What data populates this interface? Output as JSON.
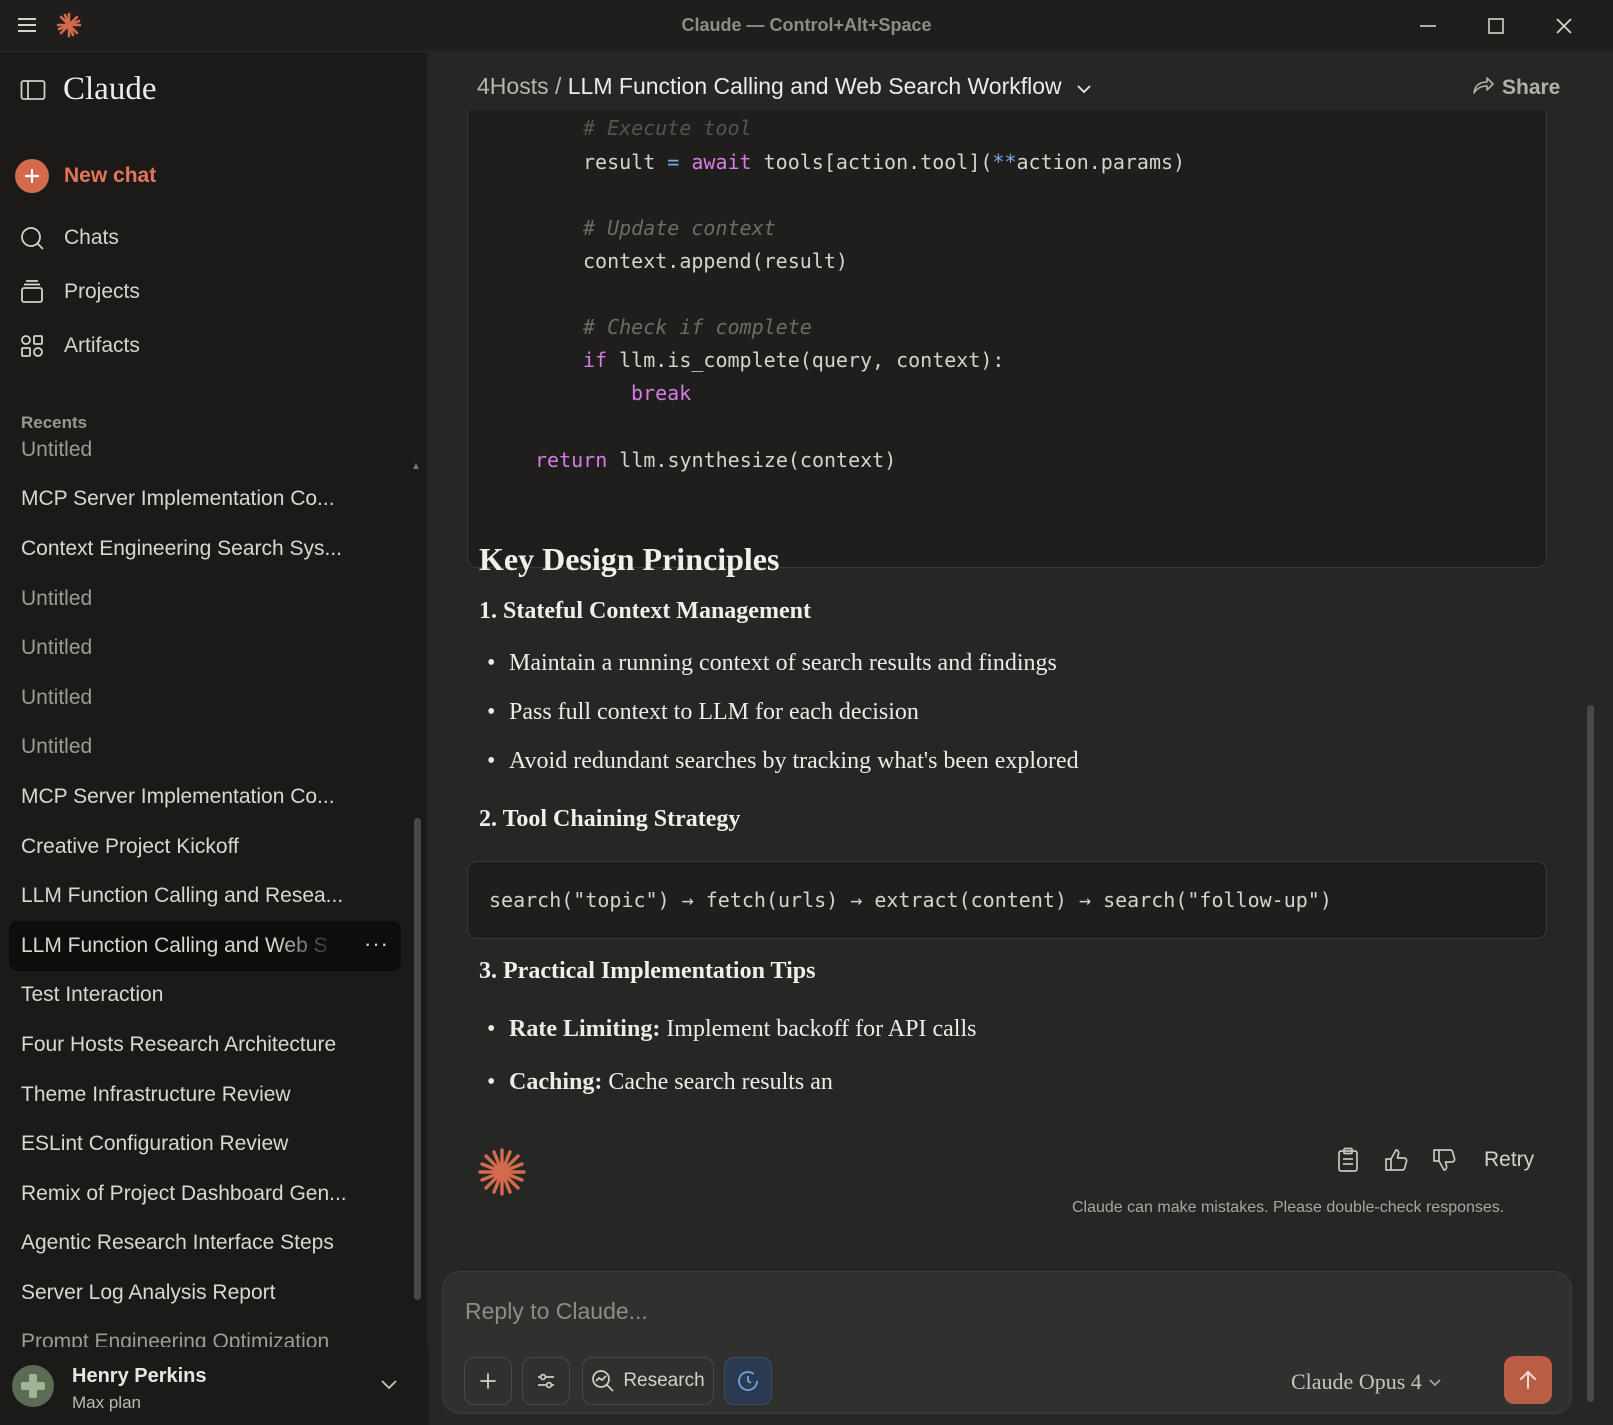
{
  "window": {
    "title": "Claude — Control+Alt+Space",
    "controls": [
      "minimize-icon",
      "maximize-icon",
      "close-icon"
    ]
  },
  "sidebar": {
    "brand": "Claude",
    "new_chat": "New chat",
    "nav": [
      {
        "label": "Chats",
        "icon": "chat-search-icon"
      },
      {
        "label": "Projects",
        "icon": "projects-icon"
      },
      {
        "label": "Artifacts",
        "icon": "artifacts-icon"
      }
    ],
    "recents_label": "Recents",
    "recents": [
      "Untitled",
      "MCP Server Implementation Co...",
      "Context Engineering Search Sys...",
      "Untitled",
      "Untitled",
      "Untitled",
      "Untitled",
      "MCP Server Implementation Co...",
      "Creative Project Kickoff",
      "LLM Function Calling and Resea...",
      "LLM Function Calling and Web S",
      "Test Interaction",
      "Four Hosts Research Architecture",
      "Theme Infrastructure Review",
      "ESLint Configuration Review",
      "Remix of Project Dashboard Gen...",
      "Agentic Research Interface Steps",
      "Server Log Analysis Report",
      "Prompt Engineering Optimization"
    ],
    "active_recent_index": 10,
    "user": {
      "name": "Henry Perkins",
      "plan": "Max plan"
    }
  },
  "header": {
    "project": "4Hosts",
    "separator": "/",
    "title": "LLM Function Calling and Web Search Workflow",
    "share": "Share"
  },
  "code": {
    "lines": [
      {
        "kind": "comment",
        "text": "# Execute tool"
      },
      {
        "kind": "result",
        "pre": "result ",
        "eq": "=",
        "aw": " await",
        "mid": " tools[action.tool](",
        "star": "**",
        "post": "action.params)"
      },
      {
        "kind": "comment",
        "text": "# Update context"
      },
      {
        "kind": "plain",
        "text": "context.append(result)"
      },
      {
        "kind": "comment",
        "text": "# Check if complete"
      },
      {
        "kind": "if",
        "kw": "if",
        "rest": " llm.is_complete(query, context):"
      },
      {
        "kind": "break",
        "kw": "break"
      },
      {
        "kind": "return",
        "kw": "return",
        "rest": " llm.synthesize(context)"
      }
    ]
  },
  "content": {
    "h2": "Key Design Principles",
    "section1": {
      "title": "1. Stateful Context Management",
      "bullets": [
        "Maintain a running context of search results and findings",
        "Pass full context to LLM for each decision",
        "Avoid redundant searches by tracking what's been explored"
      ]
    },
    "section2": {
      "title": "2. Tool Chaining Strategy",
      "code": "search(\"topic\") → fetch(urls) → extract(content) → search(\"follow-up\")"
    },
    "section3": {
      "title": "3. Practical Implementation Tips",
      "bullets": [
        {
          "bold": "Rate Limiting:",
          "text": " Implement backoff for API calls"
        },
        {
          "bold": "Caching:",
          "text": " Cache search results an"
        }
      ]
    }
  },
  "actions": {
    "retry": "Retry",
    "icons": [
      "copy-icon",
      "thumbs-up-icon",
      "thumbs-down-icon"
    ],
    "disclaimer": "Claude can make mistakes. Please double-check responses."
  },
  "composer": {
    "placeholder": "Reply to Claude...",
    "research_label": "Research",
    "model": "Claude Opus 4"
  },
  "colors": {
    "accent": "#d46a4c",
    "keyword": "#d67de2",
    "operator": "#7aa8e6",
    "comment": "#6f6c66"
  }
}
